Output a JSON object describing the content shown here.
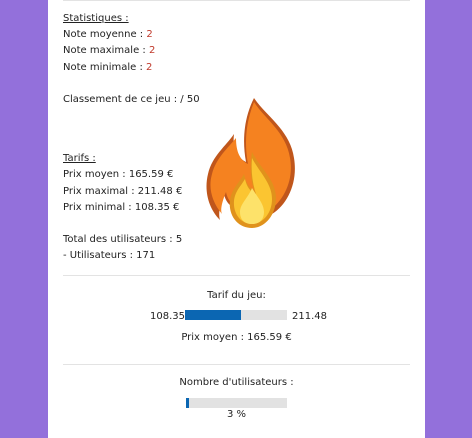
{
  "stats": {
    "heading": "Statistiques :",
    "average_label": "Note moyenne : ",
    "average_value": "2",
    "max_label": "Note maximale : ",
    "max_value": "2",
    "min_label": "Note minimale : ",
    "min_value": "2",
    "ranking": "Classement de ce jeu : / 50"
  },
  "tarifs": {
    "heading": "Tarifs :",
    "avg": "Prix moyen : 165.59 €",
    "max": "Prix maximal : 211.48 €",
    "min": "Prix minimal : 108.35 €"
  },
  "users": {
    "total": "Total des utilisateurs : 5",
    "count": "- Utilisateurs : 171"
  },
  "price_gauge": {
    "title": "Tarif du jeu:",
    "min_label": "108.35",
    "max_label": "211.48",
    "fill_fraction": 0.55,
    "avg_text": "Prix moyen : 165.59 €"
  },
  "users_gauge": {
    "title": "Nombre d'utilisateurs :",
    "fill_fraction": 0.03,
    "percent_text": "3 %"
  },
  "icons": {
    "badge": "fire-icon"
  },
  "colors": {
    "background": "#9370db",
    "value": "#c0392b",
    "gauge_fill": "#0b66b2"
  }
}
